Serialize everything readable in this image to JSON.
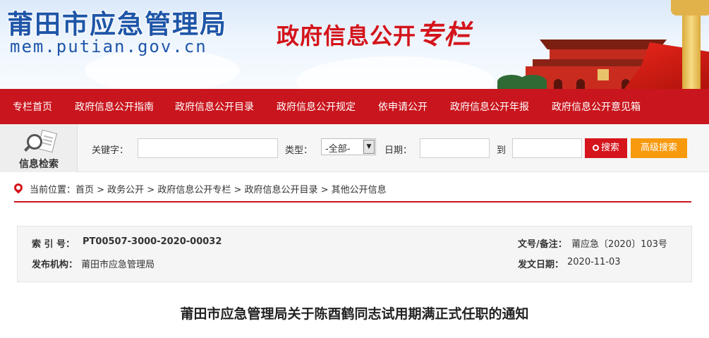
{
  "banner": {
    "site_title": "莆田市应急管理局",
    "site_domain": "mem.putian.gov.cn",
    "column_title_main": "政府信息公开",
    "column_title_accent": "专栏"
  },
  "nav": {
    "items": [
      "专栏首页",
      "政府信息公开指南",
      "政府信息公开目录",
      "政府信息公开规定",
      "依申请公开",
      "政府信息公开年报",
      "政府信息公开意见箱"
    ]
  },
  "search": {
    "logo_label": "信息检索",
    "keyword_label": "关键字：",
    "keyword_value": "",
    "type_label": "类型：",
    "type_selected": "-全部-",
    "date_label": "日期：",
    "date_from": "",
    "date_to_label": "到",
    "date_to": "",
    "search_button": "搜索",
    "advanced_button": "高级搜索"
  },
  "breadcrumb": {
    "text": "当前位置：首页 > 政务公开 > 政府信息公开专栏 > 政府信息公开目录 > 其他公开信息"
  },
  "meta": {
    "index_label": "索  引  号：",
    "index_value": "PT00507-3000-2020-00032",
    "doc_no_label": "文号/备注：",
    "doc_no_value": "莆应急〔2020〕103号",
    "publisher_label": "发布机构：",
    "publisher_value": "莆田市应急管理局",
    "date_label": "发文日期：",
    "date_value": "2020-11-03"
  },
  "document": {
    "title": "莆田市应急管理局关于陈酉鹤同志试用期满正式任职的通知"
  },
  "colors": {
    "brand_red": "#c9151d",
    "title_blue": "#1e56a8",
    "advanced_orange": "#f79a0e"
  }
}
